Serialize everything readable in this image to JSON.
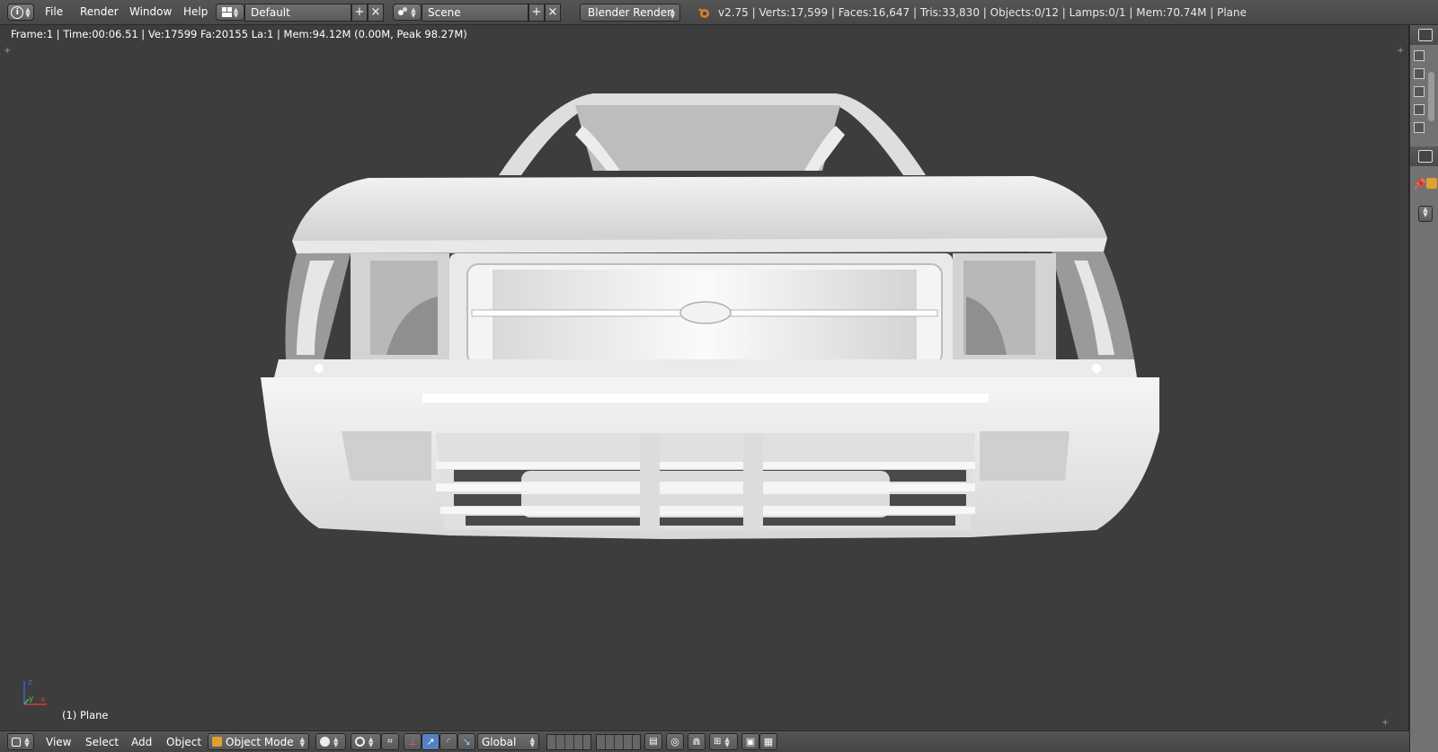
{
  "info_header": {
    "menus": [
      "File",
      "Render",
      "Window",
      "Help"
    ],
    "layout_name": "Default",
    "scene_name": "Scene",
    "engine": "Blender Render",
    "stats": "v2.75 | Verts:17,599 | Faces:16,647 | Tris:33,830 | Objects:0/12 | Lamps:0/1 | Mem:70.74M | Plane"
  },
  "viewport": {
    "render_info": "Frame:1 | Time:00:06.51 | Ve:17599 Fa:20155 La:1 | Mem:94.12M (0.00M, Peak 98.27M)",
    "object_label": "(1) Plane",
    "axes": {
      "x": "x",
      "y": "y",
      "z": "z"
    }
  },
  "view3d_header": {
    "menus": [
      "View",
      "Select",
      "Add",
      "Object"
    ],
    "mode": "Object Mode",
    "orientation": "Global"
  },
  "icons": {
    "info": "info-icon",
    "blender_logo": "blender-logo-icon",
    "layout": "screen-layout-icon",
    "scene": "scene-icon"
  },
  "colors": {
    "viewport_bg": "#3d3d3d",
    "header_bg": "#4a4a4a",
    "model": "#e4e4e4"
  }
}
